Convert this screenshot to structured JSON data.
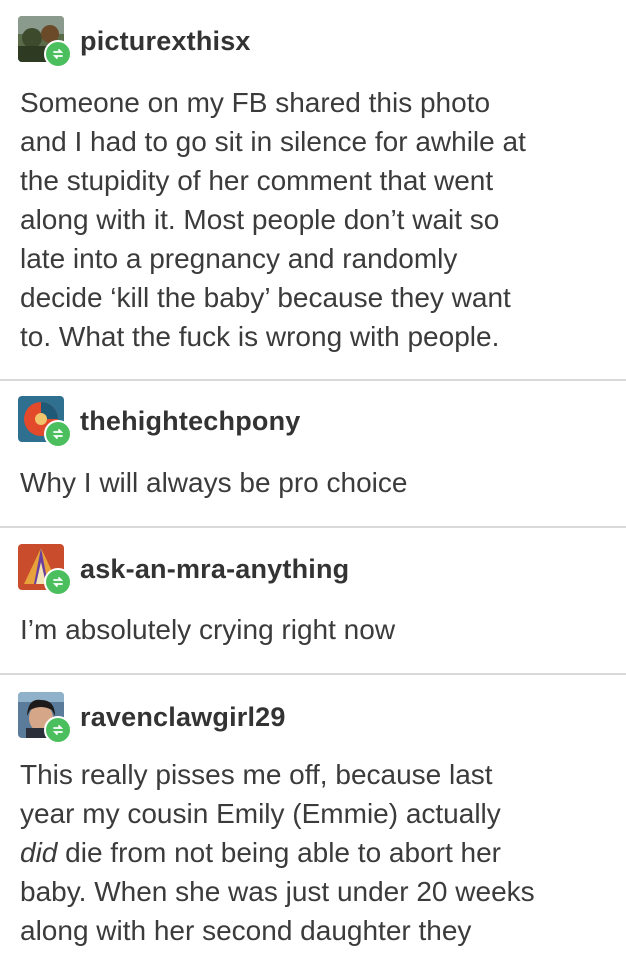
{
  "posts": [
    {
      "username": "picturexthisx",
      "lines": [
        "Someone on my FB shared this photo",
        "and I had to go sit in silence for awhile at",
        "the stupidity of her comment that went",
        "along with it. Most people don’t wait so",
        "late into a pregnancy and randomly",
        "decide ‘kill the baby’ because they want",
        "to. What the fuck is wrong with people."
      ],
      "avatar_icon": "landscape-photo-avatar"
    },
    {
      "username": "thehightechpony",
      "lines": [
        "Why I will always be pro choice"
      ],
      "avatar_icon": "pony-logo-avatar"
    },
    {
      "username": "ask-an-mra-anything",
      "lines": [
        "I’m absolutely crying right now"
      ],
      "avatar_icon": "geometric-avatar"
    },
    {
      "username": "ravenclawgirl29",
      "lines_part1_before_italic": "This really pisses me off, because last",
      "line2": "year my cousin Emily (Emmie) actually",
      "line3_italic": "did",
      "line3_rest": " die from not being able to abort her",
      "line4": "baby. When she was just under 20 weeks",
      "line5": "along with her second daughter they",
      "avatar_icon": "portrait-photo-avatar"
    }
  ],
  "icons": {
    "reblog": "reblog-icon"
  },
  "colors": {
    "reblog_badge": "#4bbf5e",
    "divider": "#d9d9d9",
    "text": "#3b3b3b"
  }
}
